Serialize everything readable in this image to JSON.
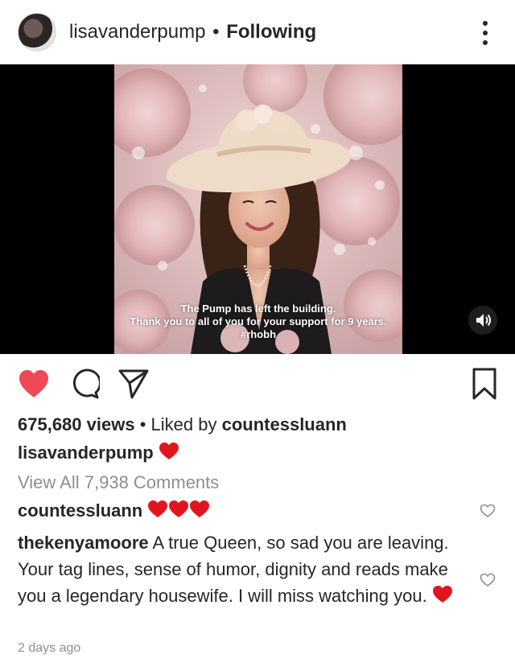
{
  "post": {
    "username": "lisavanderpump",
    "separator": "•",
    "follow_status": "Following"
  },
  "media": {
    "overlay_line1": "The Pump has left the building.",
    "overlay_line2": "Thank you to all of you for your support for 9 years.",
    "overlay_line3": "#rhobh",
    "sound_icon": "speaker-icon"
  },
  "actions": {
    "like_icon": "heart-filled-icon",
    "comment_icon": "comment-bubble-icon",
    "share_icon": "paper-plane-icon",
    "save_icon": "bookmark-icon",
    "like_color": "#ed4956"
  },
  "stats": {
    "views": "675,680 views",
    "separator": "•",
    "liked_by_prefix": "Liked by",
    "liked_by_user": "countessluann"
  },
  "owner_caption": {
    "username": "lisavanderpump"
  },
  "view_all_comments": "View All 7,938 Comments",
  "comments": [
    {
      "username": "countessluann",
      "text": ""
    },
    {
      "username": "thekenyamoore",
      "text": " A true Queen, so sad you are leaving. Your tag lines, sense of humor, dignity and reads make you a legendary housewife. I will miss watching you. "
    }
  ],
  "timestamp": "2 days ago"
}
